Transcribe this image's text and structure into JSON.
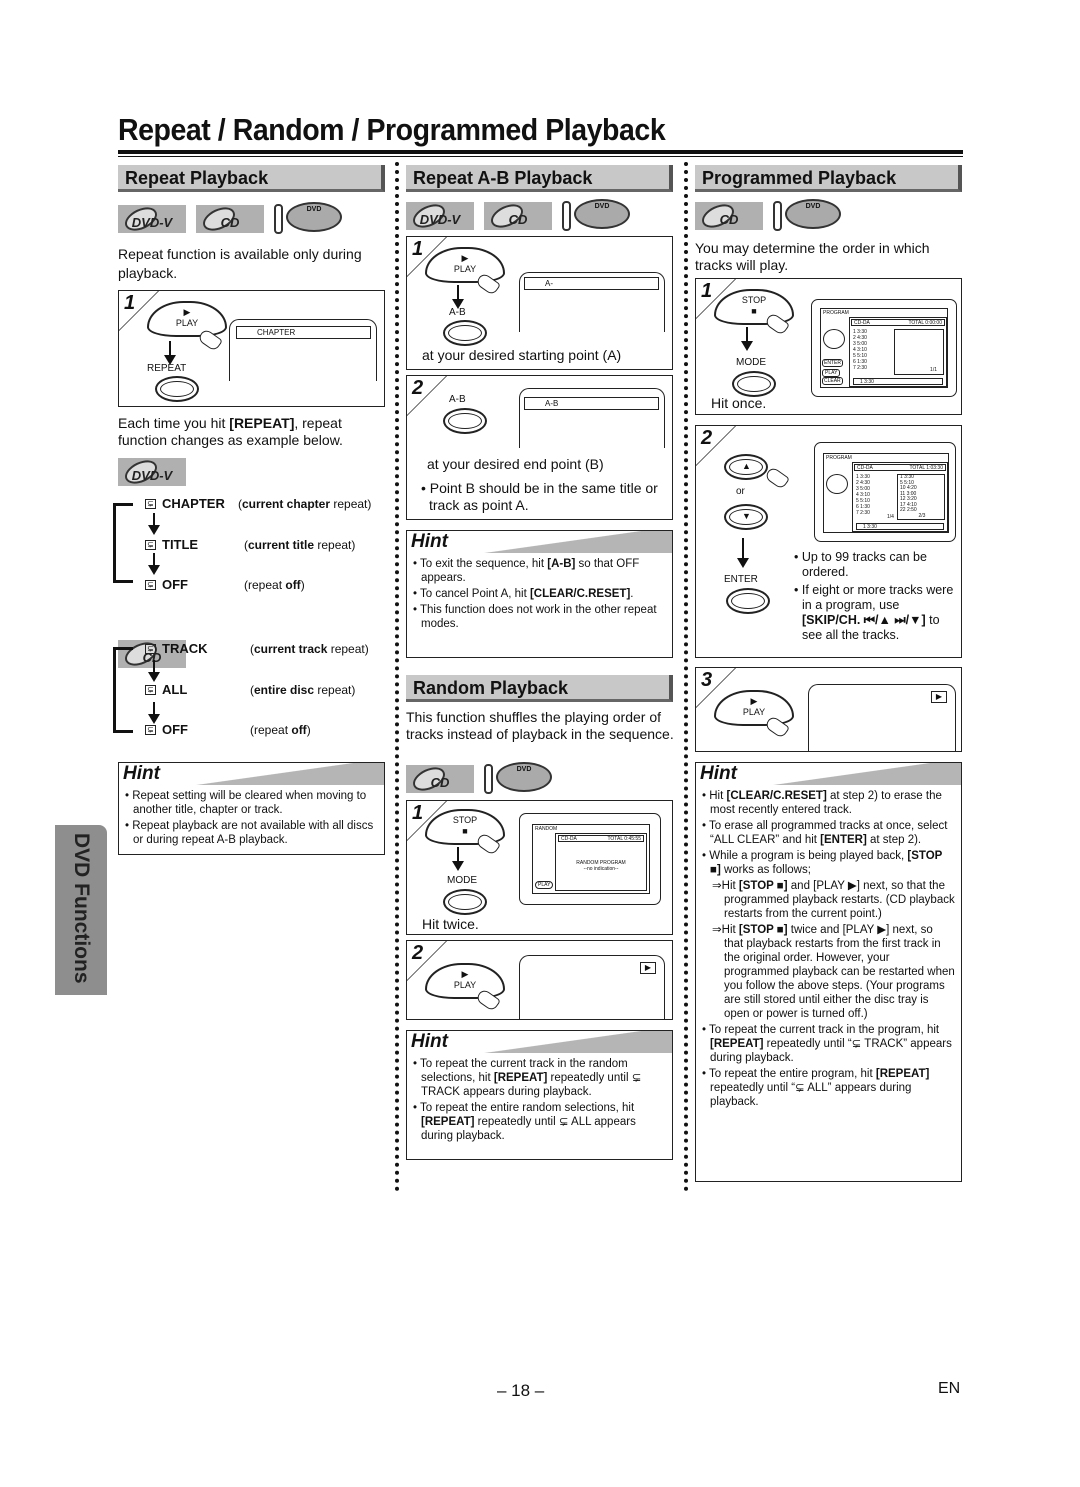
{
  "page": {
    "title": "Repeat / Random / Programmed Playback",
    "side_tab": "DVD Functions",
    "page_number": "– 18 –",
    "language": "EN"
  },
  "icons": {
    "disc_dvd": "DVD-V",
    "disc_cd": "CD",
    "remote_dvd": "DVD",
    "repeat_glyph": "⊊"
  },
  "repeat": {
    "heading": "Repeat Playback",
    "intro": "Repeat function is available only during playback.",
    "step1": {
      "num": "1",
      "play_label": "PLAY",
      "repeat_label": "REPEAT",
      "osd": "CHAPTER"
    },
    "after_text_pre": "Each time you hit ",
    "after_text_bold": "[REPEAT]",
    "after_text_post": ", repeat function changes as example below.",
    "dvd_cycle": [
      {
        "name": "CHAPTER",
        "desc_bold": "current chapter",
        "desc": " repeat"
      },
      {
        "name": "TITLE",
        "desc_bold": "current title",
        "desc": " repeat"
      },
      {
        "name": "OFF",
        "desc_pre": "repeat ",
        "desc_bold": "off"
      }
    ],
    "cd_cycle": [
      {
        "name": "TRACK",
        "desc_bold": "current track",
        "desc": " repeat"
      },
      {
        "name": "ALL",
        "desc_bold": "entire disc",
        "desc": " repeat"
      },
      {
        "name": "OFF",
        "desc_pre": "repeat ",
        "desc_bold": "off"
      }
    ],
    "hint": {
      "title": "Hint",
      "items": [
        "Repeat setting will be cleared when moving to another title, chapter or track.",
        "Repeat playback are not available with all discs or during repeat A-B playback."
      ]
    }
  },
  "ab": {
    "heading": "Repeat A-B Playback",
    "step1": {
      "num": "1",
      "play_label": "PLAY",
      "ab_label": "A-B",
      "osd": "A-",
      "caption": "at your desired starting point (A)"
    },
    "step2": {
      "num": "2",
      "ab_label": "A-B",
      "osd": "A-B",
      "caption": "at your desired end point (B)",
      "note": "Point B should be in the same title or track as point A."
    },
    "hint": {
      "title": "Hint",
      "items": [
        {
          "pre": "To exit the sequence, hit ",
          "bold": "[A-B]",
          "post": " so that OFF appears."
        },
        {
          "pre": "To cancel Point A, hit ",
          "bold": "[CLEAR/C.RESET]",
          "post": "."
        },
        {
          "pre": "This function does not work in the other repeat modes.",
          "bold": "",
          "post": ""
        }
      ]
    }
  },
  "random": {
    "heading": "Random Playback",
    "intro": "This function shuffles the playing order of tracks instead of playback in the sequence.",
    "step1": {
      "num": "1",
      "stop_label": "STOP",
      "mode_label": "MODE",
      "caption": "Hit twice.",
      "osd_title": "RANDOM",
      "osd_disc": "CD-DA",
      "osd_total": "TOTAL 0:45:55",
      "osd_msg": "RANDOM PROGRAM",
      "osd_sub": "--no indication--",
      "osd_btn": "PLAY"
    },
    "step2": {
      "num": "2",
      "play_label": "PLAY",
      "indicator": "▶"
    },
    "hint": {
      "title": "Hint",
      "items": [
        {
          "pre": "To repeat the current track in the random selections, hit ",
          "bold": "[REPEAT]",
          "post": " repeatedly until ⊊ TRACK appears during playback."
        },
        {
          "pre": "To repeat the entire random selections, hit ",
          "bold": "[REPEAT]",
          "post": " repeatedly until ⊊ ALL appears during playback."
        }
      ]
    }
  },
  "program": {
    "heading": "Programmed Playback",
    "intro": "You may determine the order in which tracks will play.",
    "step1": {
      "num": "1",
      "stop_label": "STOP",
      "mode_label": "MODE",
      "caption": "Hit once.",
      "osd_title": "PROGRAM",
      "osd_disc": "CD-DA",
      "osd_total": "TOTAL 0:00:00",
      "tracks": [
        "1  3:30",
        "2  4:30",
        "3  5:00",
        "4  3:10",
        "5  5:10",
        "6  1:30",
        "7  2:30"
      ],
      "page": "1/1",
      "selected": "1  3:30",
      "btns": [
        "ENTER",
        "PLAY",
        "CLEAR"
      ]
    },
    "step2": {
      "num": "2",
      "or_label": "or",
      "enter_label": "ENTER",
      "osd_title": "PROGRAM",
      "osd_disc": "CD-DA",
      "osd_total": "TOTAL 1:03:30",
      "tracks": [
        "1  3:30",
        "2  4:30",
        "3  5:00",
        "4  3:10",
        "5  5:10",
        "6  1:30",
        "7  2:30"
      ],
      "programmed": [
        "1  3:30",
        "5  5:10",
        "10  4:20",
        "11  3:00",
        "12  3:20",
        "17  4:10",
        "22  2:50"
      ],
      "left_page": "1/4",
      "right_page": "2/3",
      "selected": "1  3:30",
      "notes": [
        {
          "pre": "Up to 99 tracks can be ordered.",
          "bold": "",
          "post": ""
        },
        {
          "pre": "If eight or more tracks were in a program, use ",
          "bold": "[SKIP/CH. ⏮/▲ ⏭/▼]",
          "post": " to see all the tracks."
        }
      ]
    },
    "step3": {
      "num": "3",
      "play_label": "PLAY",
      "indicator": "▶"
    },
    "hint": {
      "title": "Hint",
      "items": [
        {
          "pre": "Hit ",
          "bold": "[CLEAR/C.RESET]",
          "post": " at step 2) to erase the most recently entered track.",
          "sub": false
        },
        {
          "pre": "To erase all programmed tracks at once, select “ALL CLEAR” and hit ",
          "bold": "[ENTER]",
          "post": " at step 2).",
          "sub": false
        },
        {
          "pre": "While a program is being played back, ",
          "bold": "[STOP ■]",
          "post": " works as follows;",
          "sub": false
        },
        {
          "pre": "Hit ",
          "bold": "[STOP ■]",
          "post": " and [PLAY ▶] next, so that the programmed playback restarts. (CD playback restarts from the current point.)",
          "sub": true
        },
        {
          "pre": "Hit ",
          "bold": "[STOP ■]",
          "post": " twice and [PLAY ▶] next, so that playback restarts from the first track in the original order. However, your programmed playback can be restarted when you follow the above steps. (Your programs are still stored until either the disc tray is open or power is turned off.)",
          "sub": true
        },
        {
          "pre": "To repeat the current track in the program, hit ",
          "bold": "[REPEAT]",
          "post": " repeatedly until “⊊ TRACK” appears during playback.",
          "sub": false
        },
        {
          "pre": "To repeat the entire program, hit ",
          "bold": "[REPEAT]",
          "post": " repeatedly until “⊊ ALL” appears during playback.",
          "sub": false
        }
      ]
    }
  }
}
